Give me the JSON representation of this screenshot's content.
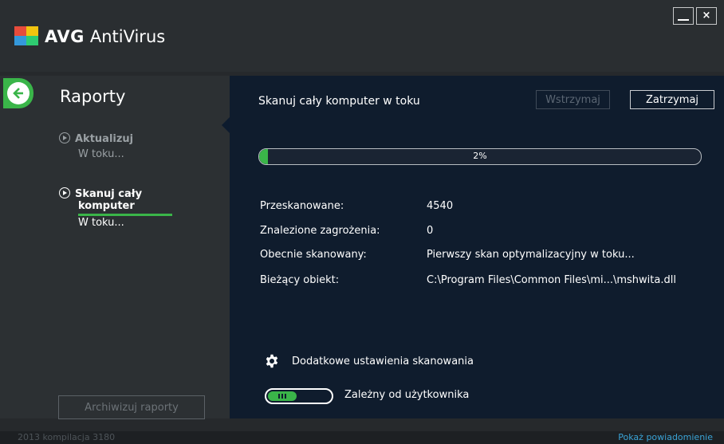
{
  "app": {
    "logo_brand": "AVG",
    "logo_product": "AntiVirus",
    "minimize_glyph": "",
    "close_glyph": "×"
  },
  "sidebar": {
    "title": "Raporty",
    "items": [
      {
        "label": "Aktualizuj",
        "status": "W toku..."
      },
      {
        "label_line1": "Skanuj cały",
        "label_line2": "komputer",
        "status": "W toku..."
      }
    ],
    "archive_button": "Archiwizuj raporty"
  },
  "main": {
    "title": "Skanuj cały komputer w toku",
    "pause_button": "Wstrzymaj",
    "stop_button": "Zatrzymaj",
    "progress": {
      "percent": 2,
      "label": "2%"
    },
    "stats": [
      {
        "label": "Przeskanowane:",
        "value": "4540"
      },
      {
        "label": "Znalezione zagrożenia:",
        "value": "0"
      },
      {
        "label": "Obecnie skanowany:",
        "value": "Pierwszy skan optymalizacyjny w toku..."
      },
      {
        "label": "Bieżący obiekt:",
        "value": "C:\\Program Files\\Common Files\\mi...\\mshwita.dll"
      }
    ],
    "settings_link": "Dodatkowe ustawienia skanowania",
    "toggle_label": "Zależny od użytkownika"
  },
  "footer": {
    "build": "2013  kompilacja 3180",
    "notifications_link": "Pokaż powiadomienie"
  },
  "colors": {
    "accent_green": "#3ab549",
    "main_bg": "#0f1c2d",
    "link_blue": "#3aa3d6"
  },
  "icons": [
    "back-arrow-icon",
    "play-circle-icon",
    "gear-icon",
    "minimize-icon",
    "close-icon"
  ]
}
